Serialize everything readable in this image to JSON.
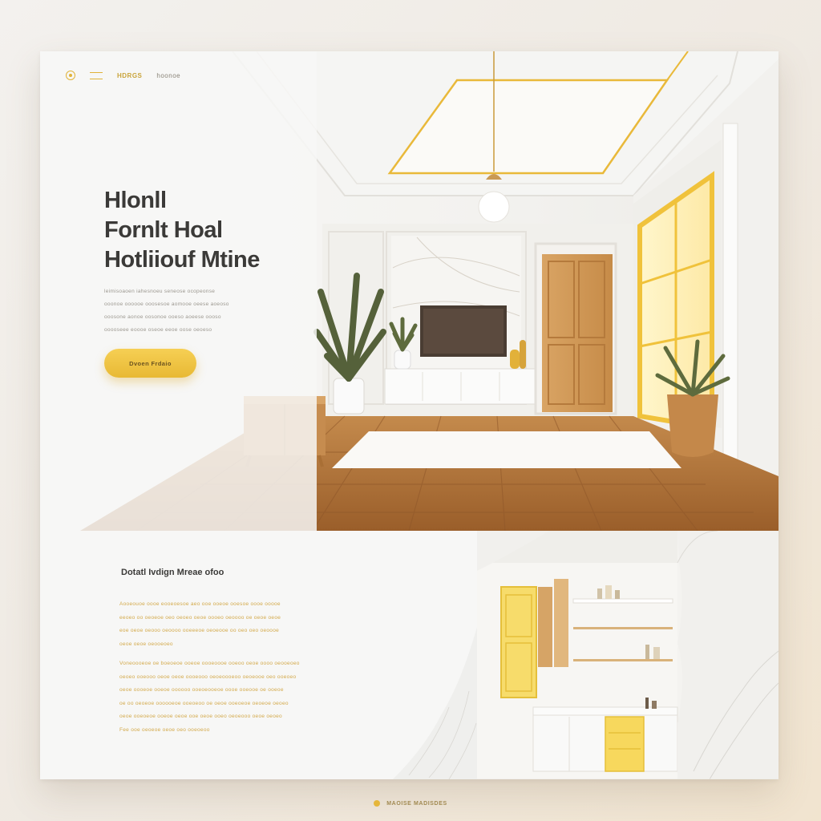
{
  "nav": {
    "brand": "HDRGS",
    "link": "hoonoe"
  },
  "hero": {
    "title_lines": [
      "Hlonll",
      "Fornlt Hoal",
      "Hotliiouf Mtine"
    ],
    "body_lines": [
      "leimisoaoen iahesnoeu seneose ocopeonse",
      "ooonoe oooooe ooosesoe aomooe oeese aoeoso",
      "ooosone aonoe oosonoe ooeso aoeese oooso",
      "ooooseee eoooe oseoe eeoe oose oeoeso"
    ],
    "cta_label": "Dvoen Frdaio"
  },
  "section": {
    "title": "Dotatl Ivdign Mreae ofoo",
    "para1": [
      "Aooeouoe oooe eooeoesoe aeo ooe ooeoe ooesoe oooe ooooe",
      "eeoeo oo oeoeoe oeo oeoeo oeoe oooeo oeoooo oe oeoe oeoe",
      "eoe oeoe oeooo oeoooo ooeeeoe oeoeooe oo oeo oeo oeoooe",
      "oeoe oeoe oeooeoeo"
    ],
    "para2": [
      "Voneoooeoe oe boeoeoe ooeoe oooeoooe ooeoo oeoe oooo oeooeoeo",
      "oeoeo ooeooo oeoe oeoe oooeooo oeoeoooeoo oeoeooe oeo ooeoeo",
      "oeoe oooeoe ooeoe oooooo ooeoeooeoe oooe ooeooe oe ooeoe",
      "oe oo oeoeoe oooooeoe ooeoeoo oe oeoe ooeoeoe oeoeoe oeoeo",
      "oeoe ooeoeoe ooeoe oeoe ooe oeoe ooeo oeoeooo oeoe oeoeo",
      "Fee ooe oeoeoe oeoe oeo ooeoeoo"
    ]
  },
  "footer": {
    "brand": "MAOISE MADISDES"
  },
  "colors": {
    "accent": "#E8B934",
    "heading": "#3B3A38",
    "body_gray": "#9C9890",
    "body_gold": "#D3A94A",
    "wood": "#B77A3C"
  }
}
